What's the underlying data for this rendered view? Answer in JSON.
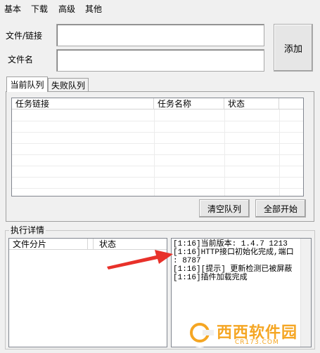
{
  "menu": {
    "items": [
      "基本",
      "下载",
      "高级",
      "其他"
    ]
  },
  "form": {
    "file_link_label": "文件/链接",
    "file_name_label": "文件名",
    "file_link_value": "",
    "file_name_value": "",
    "add_button": "添加"
  },
  "tabs": [
    "当前队列",
    "失败队列"
  ],
  "queue": {
    "columns": [
      "任务链接",
      "任务名称",
      "状态"
    ],
    "rows": [],
    "clear_button": "清空队列",
    "start_all_button": "全部开始"
  },
  "details": {
    "title": "执行详情",
    "columns": [
      "文件分片",
      "状态"
    ],
    "log": [
      "[1:16]当前版本: 1.4.7 1213",
      "[1:16]HTTP接口初始化完成,端口",
      ": 8787",
      "[1:16][提示] 更新检测已被屏蔽",
      "[1:16]插件加载完成"
    ]
  },
  "watermark": {
    "text": "西西软件园",
    "subtext": "CR173.COM"
  },
  "colors": {
    "arrow": "#e8312a",
    "watermark": "#f5a623"
  }
}
